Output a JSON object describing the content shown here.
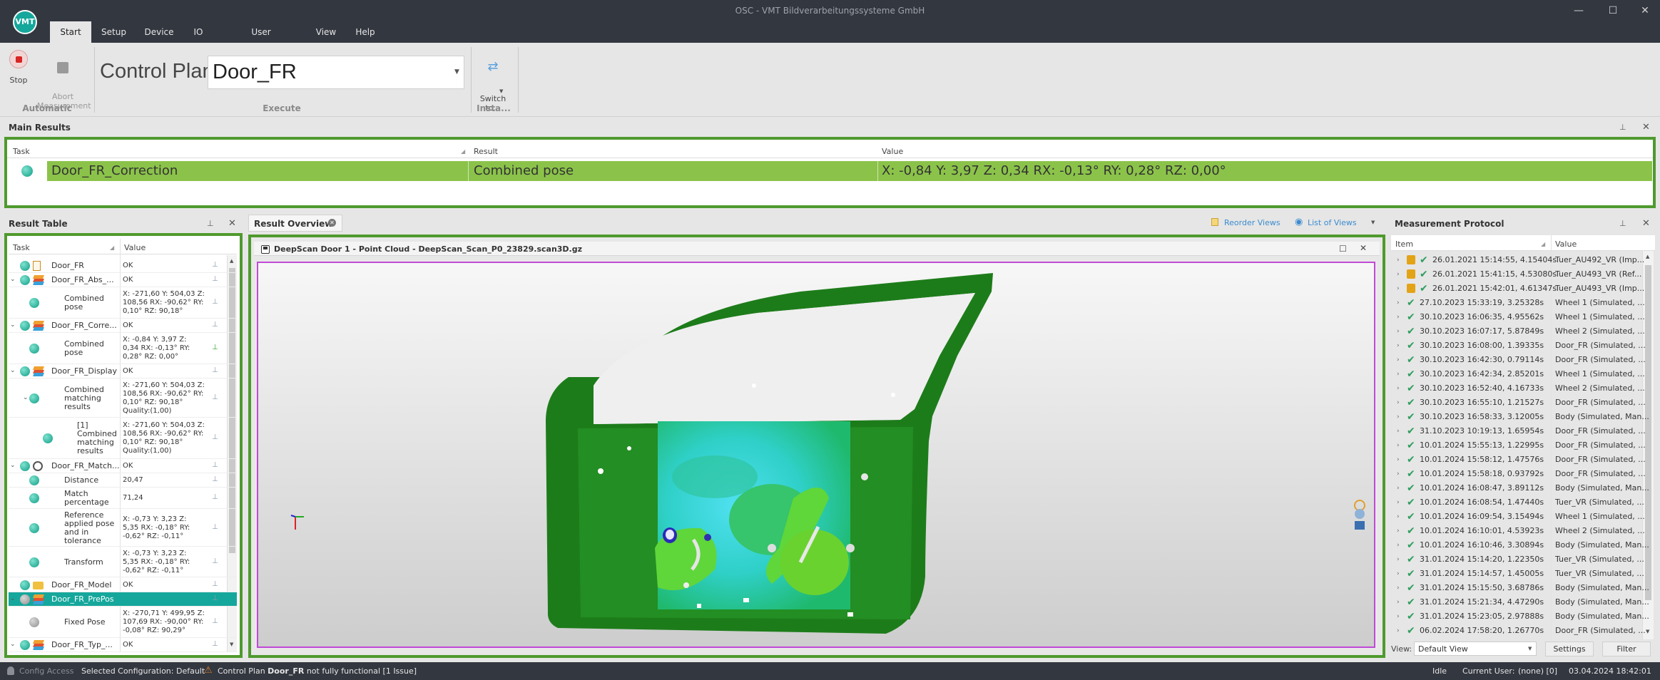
{
  "window": {
    "title": "OSC - VMT Bildverarbeitungssysteme GmbH",
    "logo_text": "VMT",
    "min": "—",
    "max": "☐",
    "close": "✕"
  },
  "menu": [
    {
      "label": "Start"
    },
    {
      "label": "Setup"
    },
    {
      "label": "Device"
    },
    {
      "label": "IO"
    },
    {
      "label": "User Administration"
    },
    {
      "label": "View"
    },
    {
      "label": "Help"
    }
  ],
  "ribbon": {
    "stop_label": "Stop",
    "abort_label": "Abort\nMeasurement",
    "group_automatic": "Automatic",
    "control_plan_label": "Control Plan",
    "control_plan_value": "Door_FR",
    "group_execute": "Execute",
    "switch_label": "Switch\nto...",
    "group_insta": "Insta..."
  },
  "main_results": {
    "title": "Main Results",
    "headers": {
      "task": "Task",
      "result": "Result",
      "value": "Value"
    },
    "row": {
      "task": "Door_FR_Correction",
      "result": "Combined pose",
      "value": "X: -0,84 Y: 3,97 Z: 0,34 RX: -0,13° RY: 0,28° RZ: 0,00°",
      "color": "#8bc34a"
    }
  },
  "result_table": {
    "title": "Result Table",
    "headers": {
      "task": "Task",
      "value": "Value"
    },
    "rows": [
      {
        "task": "Door_FR",
        "value": "OK"
      },
      {
        "task": "Door_FR_Abs_...",
        "value": "OK"
      },
      {
        "task": "Combined\npose",
        "value": "X: -271,60 Y: 504,03 Z:\n108,56 RX: -90,62° RY:\n0,10° RZ: 90,18°"
      },
      {
        "task": "Door_FR_Corre...",
        "value": "OK"
      },
      {
        "task": "Combined\npose",
        "value": "X: -0,84 Y: 3,97 Z:\n0,34 RX: -0,13° RY:\n0,28° RZ: 0,00°"
      },
      {
        "task": "Door_FR_Display",
        "value": "OK"
      },
      {
        "task": "Combined\nmatching\nresults",
        "value": "X: -271,60 Y: 504,03 Z:\n108,56 RX: -90,62° RY:\n0,10° RZ: 90,18°\nQuality:(1,00)"
      },
      {
        "task": "[1]\nCombined\nmatching\nresults",
        "value": "X: -271,60 Y: 504,03 Z:\n108,56 RX: -90,62° RY:\n0,10° RZ: 90,18°\nQuality:(1,00)"
      },
      {
        "task": "Door_FR_Match...",
        "value": "OK"
      },
      {
        "task": "Distance",
        "value": "20,47"
      },
      {
        "task": "Match\npercentage",
        "value": "71,24"
      },
      {
        "task": "Reference\napplied pose\nand in\ntolerance",
        "value": "X: -0,73 Y: 3,23 Z:\n5,35 RX: -0,18° RY:\n-0,62° RZ: -0,11°"
      },
      {
        "task": "Transform",
        "value": "X: -0,73 Y: 3,23 Z:\n5,35 RX: -0,18° RY:\n-0,62° RZ: -0,11°"
      },
      {
        "task": "Door_FR_Model",
        "value": "OK"
      },
      {
        "task": "Door_FR_PrePos",
        "value": ""
      },
      {
        "task": "Fixed Pose",
        "value": "X: -270,71 Y: 499,95 Z:\n107,69 RX: -90,00° RY:\n-0,08° RZ: 90,29°"
      },
      {
        "task": "Door_FR_Typ_...",
        "value": "OK"
      }
    ]
  },
  "result_overview": {
    "tab_label": "Result Overview",
    "reorder_views": "Reorder Views",
    "list_of_views": "List of Views",
    "view_title": "DeepScan Door 1 - Point Cloud - DeepScan_Scan_P0_23829.scan3D.gz"
  },
  "measurement_protocol": {
    "title": "Measurement Protocol",
    "headers": {
      "item": "Item",
      "value": "Value"
    },
    "rows": [
      {
        "item": "26.01.2021 15:14:55, 4.15404s",
        "value": "Tuer_AU492_VR (Imp...",
        "locked": true
      },
      {
        "item": "26.01.2021 15:41:15, 4.53080s",
        "value": "Tuer_AU493_VR (Ref...",
        "locked": true
      },
      {
        "item": "26.01.2021 15:42:01, 4.61347s",
        "value": "Tuer_AU493_VR (Imp...",
        "locked": true
      },
      {
        "item": "27.10.2023 15:33:19, 3.25328s",
        "value": "Wheel 1 (Simulated, ...",
        "locked": false
      },
      {
        "item": "30.10.2023 16:06:35, 4.95562s",
        "value": "Wheel 1 (Simulated, ...",
        "locked": false
      },
      {
        "item": "30.10.2023 16:07:17, 5.87849s",
        "value": "Wheel 2 (Simulated, ...",
        "locked": false
      },
      {
        "item": "30.10.2023 16:08:00, 1.39335s",
        "value": "Door_FR (Simulated, ...",
        "locked": false
      },
      {
        "item": "30.10.2023 16:42:30, 0.79114s",
        "value": "Door_FR (Simulated, ...",
        "locked": false
      },
      {
        "item": "30.10.2023 16:42:34, 2.85201s",
        "value": "Wheel 1 (Simulated, ...",
        "locked": false
      },
      {
        "item": "30.10.2023 16:52:40, 4.16733s",
        "value": "Wheel 2 (Simulated, ...",
        "locked": false
      },
      {
        "item": "30.10.2023 16:55:10, 1.21527s",
        "value": "Door_FR (Simulated, ...",
        "locked": false
      },
      {
        "item": "30.10.2023 16:58:33, 3.12005s",
        "value": "Body (Simulated, Man...",
        "locked": false
      },
      {
        "item": "31.10.2023 10:19:13, 1.65954s",
        "value": "Door_FR (Simulated, ...",
        "locked": false
      },
      {
        "item": "10.01.2024 15:55:13, 1.22995s",
        "value": "Door_FR (Simulated, ...",
        "locked": false
      },
      {
        "item": "10.01.2024 15:58:12, 1.47576s",
        "value": "Door_FR (Simulated, ...",
        "locked": false
      },
      {
        "item": "10.01.2024 15:58:18, 0.93792s",
        "value": "Door_FR (Simulated, ...",
        "locked": false
      },
      {
        "item": "10.01.2024 16:08:47, 3.89112s",
        "value": "Body (Simulated, Man...",
        "locked": false
      },
      {
        "item": "10.01.2024 16:08:54, 1.47440s",
        "value": "Tuer_VR (Simulated, ...",
        "locked": false
      },
      {
        "item": "10.01.2024 16:09:54, 3.15494s",
        "value": "Wheel 1 (Simulated, ...",
        "locked": false
      },
      {
        "item": "10.01.2024 16:10:01, 4.53923s",
        "value": "Wheel 2 (Simulated, ...",
        "locked": false
      },
      {
        "item": "10.01.2024 16:10:46, 3.30894s",
        "value": "Body (Simulated, Man...",
        "locked": false
      },
      {
        "item": "31.01.2024 15:14:20, 1.22350s",
        "value": "Tuer_VR (Simulated, ...",
        "locked": false
      },
      {
        "item": "31.01.2024 15:14:57, 1.45005s",
        "value": "Tuer_VR (Simulated, ...",
        "locked": false
      },
      {
        "item": "31.01.2024 15:15:50, 3.68786s",
        "value": "Body (Simulated, Man...",
        "locked": false
      },
      {
        "item": "31.01.2024 15:21:34, 4.47290s",
        "value": "Body (Simulated, Man...",
        "locked": false
      },
      {
        "item": "31.01.2024 15:23:05, 2.97888s",
        "value": "Body (Simulated, Man...",
        "locked": false
      },
      {
        "item": "06.02.2024 17:58:20, 1.26770s",
        "value": "Door_FR (Simulated, ...",
        "locked": false
      }
    ],
    "view_label": "View:",
    "view_value": "Default View",
    "settings": "Settings",
    "filter": "Filter"
  },
  "status": {
    "config_access": "Config Access",
    "selected_config": "Selected Configuration: Default",
    "issue_prefix": "Control Plan",
    "issue_plan": "Door_FR",
    "issue_suffix": "not fully functional [1 Issue]",
    "state": "Idle",
    "user_label": "Current User:",
    "user_value": "(none) [0]",
    "datetime": "03.04.2024 18:42:01"
  },
  "colors": {
    "accent_green": "#4f9a2e",
    "row_green": "#8bc34a",
    "teal": "#16a79c",
    "dark": "#333740"
  }
}
